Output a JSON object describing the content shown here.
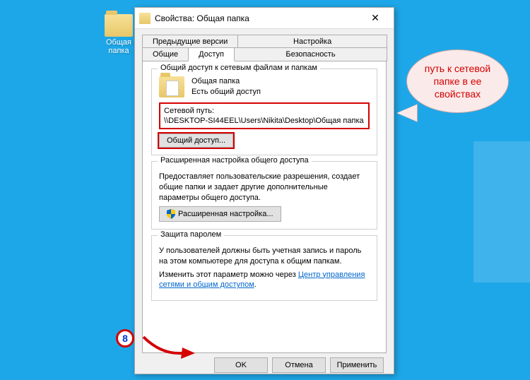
{
  "desktop": {
    "folder_label": "Общая\nпапка"
  },
  "dialog": {
    "title": "Свойства: Общая папка",
    "tabs": {
      "prev_versions": "Предыдущие версии",
      "settings": "Настройка",
      "general": "Общие",
      "sharing": "Доступ",
      "security": "Безопасность"
    },
    "group_sharing": {
      "title": "Общий доступ к сетевым файлам и папкам",
      "folder_name": "Общая папка",
      "status": "Есть общий доступ",
      "netpath_label": "Сетевой путь:",
      "netpath_value": "\\\\DESKTOP-SI44EEL\\Users\\Nikita\\Desktop\\Общая папка",
      "share_btn": "Общий доступ..."
    },
    "group_advanced": {
      "title": "Расширенная настройка общего доступа",
      "desc": "Предоставляет пользовательские разрешения, создает общие папки и задает другие дополнительные параметры общего доступа.",
      "btn": "Расширенная настройка..."
    },
    "group_password": {
      "title": "Защита паролем",
      "desc": "У пользователей должны быть учетная запись и пароль на этом компьютере для доступа к общим папкам.",
      "change_prefix": "Изменить этот параметр можно через ",
      "link": "Центр управления сетями и общим доступом",
      "change_suffix": "."
    },
    "buttons": {
      "ok": "OK",
      "cancel": "Отмена",
      "apply": "Применить"
    }
  },
  "callout": {
    "text": "путь к сетевой папке в ее свойствах"
  },
  "step": {
    "num": "8"
  }
}
